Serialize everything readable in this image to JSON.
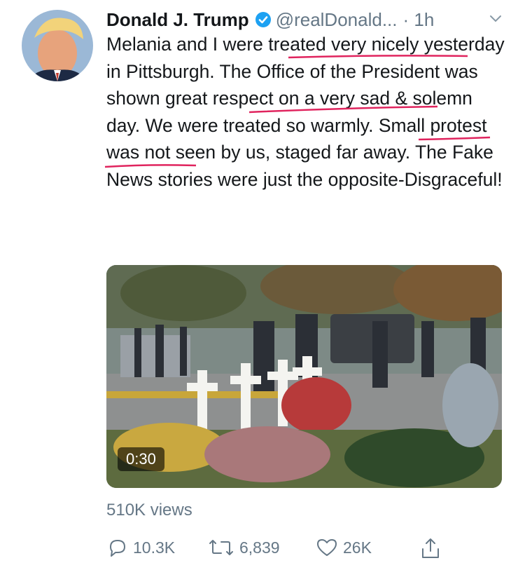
{
  "tweet": {
    "author_name": "Donald J. Trump",
    "handle": "@realDonald...",
    "time": "· 1h",
    "text_parts": [
      "Melania and I were ",
      "treated very nicely",
      " yesterday in Pittsburgh. The Office of the President was ",
      "shown great respect",
      " on a very sad & solemn day. We were ",
      "treated so warmly",
      ". Small protest was not seen by us, staged far away. The Fake News stories were just the opposite-Disgraceful!"
    ],
    "underline_color": "#e0245e"
  },
  "media": {
    "duration": "0:30",
    "views": "510K views"
  },
  "actions": {
    "replies": "10.3K",
    "retweets": "6,839",
    "likes": "26K"
  },
  "icons": [
    "verified-badge-icon",
    "chevron-down-icon",
    "reply-icon",
    "retweet-icon",
    "like-icon",
    "share-icon"
  ],
  "colors": {
    "verified": "#1da1f2",
    "muted": "#657786",
    "text": "#14171a"
  }
}
